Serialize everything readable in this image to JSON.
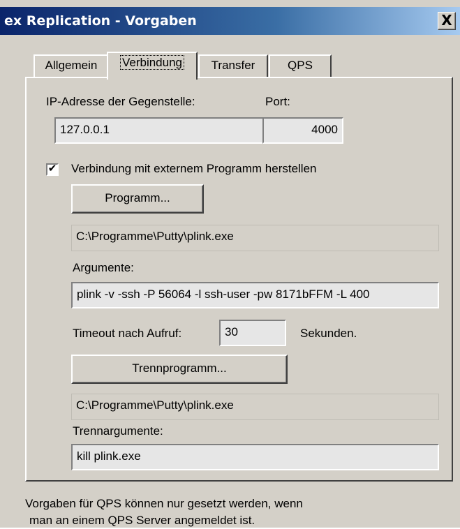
{
  "window": {
    "title": "ex Replication - Vorgaben",
    "close_label": "X"
  },
  "tabs": [
    {
      "label": "Allgemein",
      "active": false
    },
    {
      "label": "Verbindung",
      "active": true
    },
    {
      "label": "Transfer",
      "active": false
    },
    {
      "label": "QPS",
      "active": false
    }
  ],
  "connection": {
    "ip_label": "IP-Adresse der Gegenstelle:",
    "ip_value": "127.0.0.1",
    "port_label": "Port:",
    "port_value": "4000",
    "external_checkbox_label": "Verbindung mit externem Programm herstellen",
    "external_checked": true,
    "check_mark": "✔",
    "program_button": "Programm...",
    "program_path": "C:\\Programme\\Putty\\plink.exe",
    "arguments_label": "Argumente:",
    "arguments_value": "plink -v -ssh -P 56064 -l ssh-user -pw 8171bFFM -L 400",
    "timeout_label": "Timeout nach Aufruf:",
    "timeout_value": "30",
    "timeout_unit": "Sekunden.",
    "disconnect_button": "Trennprogramm...",
    "disconnect_path": "C:\\Programme\\Putty\\plink.exe",
    "disconnect_args_label": "Trennargumente:",
    "disconnect_args_value": "kill plink.exe"
  },
  "footer": {
    "line1": "Vorgaben für QPS können nur gesetzt werden, wenn",
    "line2": "man an einem QPS Server angemeldet ist."
  }
}
